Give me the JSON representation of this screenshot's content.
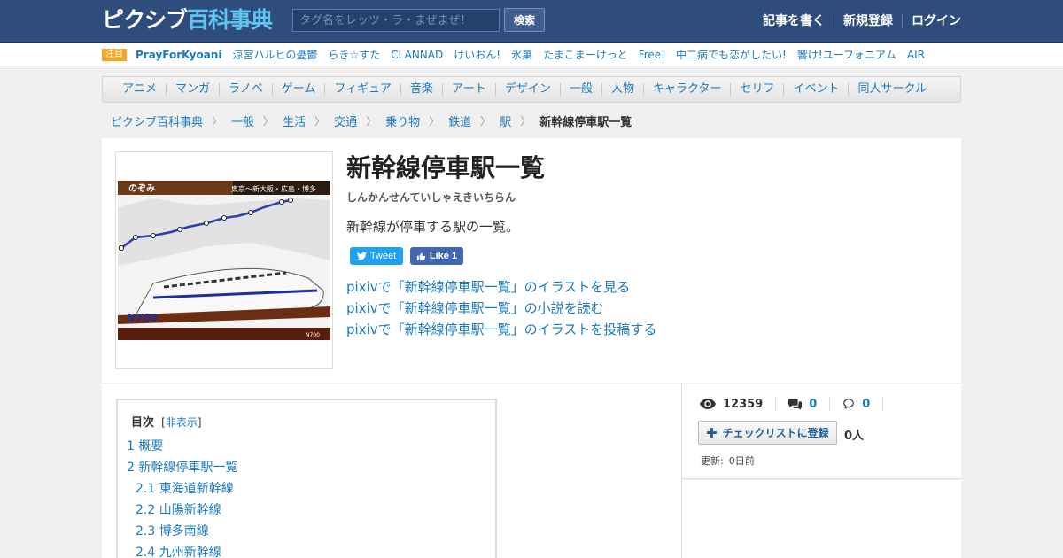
{
  "header": {
    "logo_part1": "ピクシブ",
    "logo_part2": "百科事典",
    "search_placeholder": "タグ名をレッツ・ラ・まぜまぜ！",
    "search_button": "検索",
    "nav": [
      "記事を書く",
      "新規登録",
      "ログイン"
    ]
  },
  "featured": {
    "badge": "注目",
    "items": [
      "PrayForKyoani",
      "涼宮ハルヒの憂鬱",
      "らき☆すた",
      "CLANNAD",
      "けいおん!",
      "氷菓",
      "たまこまーけっと",
      "Free!",
      "中二病でも恋がしたい!",
      "響け!ユーフォニアム",
      "AIR"
    ]
  },
  "categories": [
    "アニメ",
    "マンガ",
    "ラノベ",
    "ゲーム",
    "フィギュア",
    "音楽",
    "アート",
    "デザイン",
    "一般",
    "人物",
    "キャラクター",
    "セリフ",
    "イベント",
    "同人サークル"
  ],
  "breadcrumb": [
    "ピクシブ百科事典",
    "一般",
    "生活",
    "交通",
    "乗り物",
    "鉄道",
    "駅"
  ],
  "breadcrumb_current": "新幹線停車駅一覧",
  "article": {
    "title": "新幹線停車駅一覧",
    "reading": "しんかんせんていしゃえきいちらん",
    "description": "新幹線が停車する駅の一覧。",
    "tweet_label": "Tweet",
    "like_label": "Like 1",
    "links": [
      "pixivで「新幹線停車駅一覧」のイラストを見る",
      "pixivで「新幹線停車駅一覧」の小説を読む",
      "pixivで「新幹線停車駅一覧」のイラストを投稿する"
    ],
    "image": {
      "banner_left": "のぞみ",
      "banner_right": "東京～新大阪・広島・博多",
      "model": "N700",
      "caption": "N700"
    }
  },
  "toc": {
    "title": "目次",
    "toggle_open": "[",
    "toggle": "非表示",
    "toggle_close": "]",
    "items": [
      "1 概要",
      "2 新幹線停車駅一覧",
      "2.1 東海道新幹線",
      "2.2 山陽新幹線",
      "2.3 博多南線",
      "2.4 九州新幹線"
    ]
  },
  "sidebar": {
    "views": "12359",
    "comments": "0",
    "replies": "0",
    "checklist_button": "チェックリストに登録",
    "checklist_count": "0人",
    "updated_label": "更新:",
    "updated_value": "0日前"
  },
  "colors": {
    "header_bg": "#2e4d7d",
    "logo_accent": "#5fc4f0",
    "link": "#1c7bbd",
    "twitter": "#1da1f2",
    "facebook": "#4267b2",
    "badge": "#f5a623"
  }
}
